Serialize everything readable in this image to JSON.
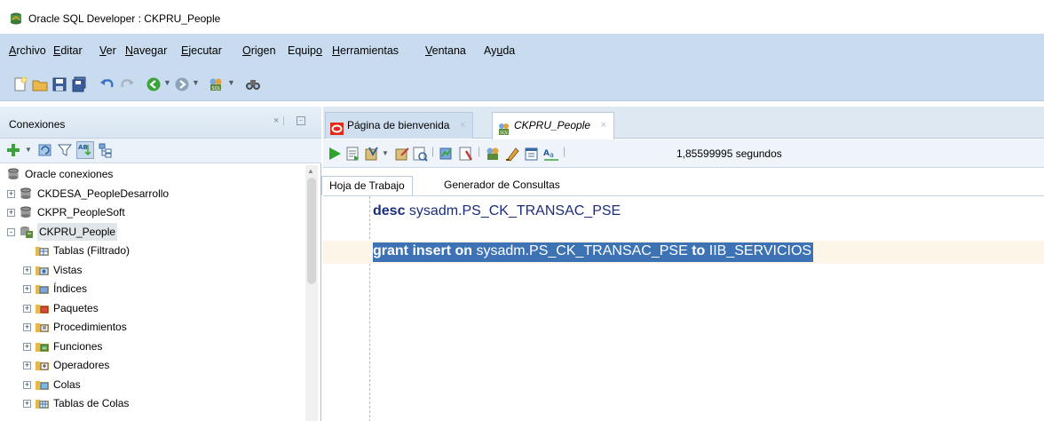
{
  "window": {
    "title": "Oracle SQL Developer : CKPRU_People"
  },
  "menu": {
    "items": [
      {
        "pre": "",
        "u": "A",
        "post": "rchivo"
      },
      {
        "pre": "",
        "u": "E",
        "post": "ditar"
      },
      {
        "pre": "",
        "u": "V",
        "post": "er"
      },
      {
        "pre": "",
        "u": "N",
        "post": "avegar"
      },
      {
        "pre": "",
        "u": "E",
        "post": "jecutar"
      },
      {
        "pre": "",
        "u": "O",
        "post": "rigen"
      },
      {
        "pre": "Equip",
        "u": "o",
        "post": ""
      },
      {
        "pre": "",
        "u": "H",
        "post": "erramientas"
      },
      {
        "pre": "",
        "u": "V",
        "post": "entana"
      },
      {
        "pre": "Ay",
        "u": "u",
        "post": "da"
      }
    ]
  },
  "connections": {
    "header": "Conexiones",
    "tree": [
      {
        "label": "Oracle conexiones",
        "icon": "database-icon",
        "level": 0,
        "expander": ""
      },
      {
        "label": "CKDESA_PeopleDesarrollo",
        "icon": "database-icon",
        "level": 1,
        "expander": "+"
      },
      {
        "label": "CKPR_PeopleSoft",
        "icon": "database-icon",
        "level": 1,
        "expander": "+"
      },
      {
        "label": "CKPRU_People",
        "icon": "connection-icon",
        "level": 1,
        "expander": "-",
        "selected": true
      },
      {
        "label": "Tablas (Filtrado)",
        "icon": "table-folder-icon",
        "level": 2,
        "expander": ""
      },
      {
        "label": "Vistas",
        "icon": "view-folder-icon",
        "level": 2,
        "expander": "+"
      },
      {
        "label": "Índices",
        "icon": "index-folder-icon",
        "level": 2,
        "expander": "+"
      },
      {
        "label": "Paquetes",
        "icon": "package-folder-icon",
        "level": 2,
        "expander": "+"
      },
      {
        "label": "Procedimientos",
        "icon": "procedure-folder-icon",
        "level": 2,
        "expander": "+"
      },
      {
        "label": "Funciones",
        "icon": "function-folder-icon",
        "level": 2,
        "expander": "+"
      },
      {
        "label": "Operadores",
        "icon": "operator-folder-icon",
        "level": 2,
        "expander": "+"
      },
      {
        "label": "Colas",
        "icon": "queue-folder-icon",
        "level": 2,
        "expander": "+"
      },
      {
        "label": "Tablas de Colas",
        "icon": "queue-table-folder-icon",
        "level": 2,
        "expander": "+"
      }
    ]
  },
  "tabs": [
    {
      "label": "Página de bienvenida",
      "icon": "oracle-icon",
      "active": false
    },
    {
      "label": "CKPRU_People",
      "icon": "sql-worksheet-icon",
      "active": true
    }
  ],
  "editor_toolbar": {
    "elapsed": "1,85599995 segundos"
  },
  "subtabs": [
    {
      "label": "Hoja de Trabajo",
      "active": true
    },
    {
      "label": "Generador de Consultas",
      "active": false
    }
  ],
  "editor": {
    "line1": {
      "kw": "desc",
      "rest": " sysadm.PS_CK_TRANSAC_PSE"
    },
    "line2": {
      "kw1": "grant insert on",
      "mid": " sysadm.PS_CK_TRANSAC_PSE ",
      "kw2": "to",
      "end": " IIB_SERVICIOS"
    }
  },
  "colors": {
    "menubar_bg": "#c9dcef",
    "selection": "#3d72b4",
    "keyword": "#1a2d7a"
  }
}
